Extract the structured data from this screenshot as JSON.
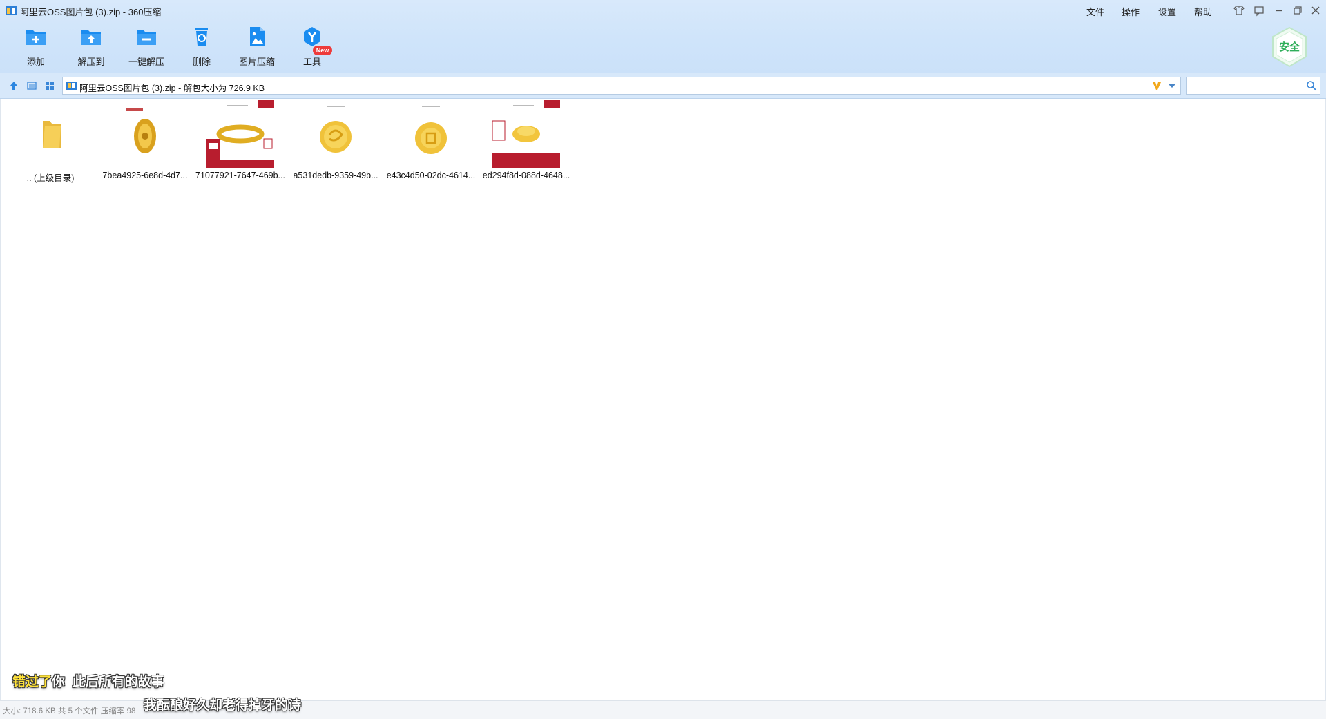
{
  "window": {
    "title": "阿里云OSS图片包 (3).zip - 360压缩",
    "menu": [
      "文件",
      "操作",
      "设置",
      "帮助"
    ]
  },
  "toolbar": {
    "tools": [
      {
        "label": "添加",
        "icon": "add-folder-icon"
      },
      {
        "label": "解压到",
        "icon": "extract-to-icon"
      },
      {
        "label": "一键解压",
        "icon": "one-click-extract-icon"
      },
      {
        "label": "删除",
        "icon": "delete-icon"
      },
      {
        "label": "图片压缩",
        "icon": "image-compress-icon"
      },
      {
        "label": "工具",
        "icon": "tools-icon"
      }
    ],
    "new_badge": "New",
    "safe_badge": "安全"
  },
  "address": {
    "path": "阿里云OSS图片包 (3).zip - 解包大小为 726.9 KB"
  },
  "search": {
    "placeholder": "",
    "value": ""
  },
  "files": [
    {
      "name": ".. (上级目录)",
      "kind": "parent-folder"
    },
    {
      "name": "7bea4925-6e8d-4d7...",
      "kind": "image"
    },
    {
      "name": "71077921-7647-469b...",
      "kind": "image"
    },
    {
      "name": "a531dedb-9359-49b...",
      "kind": "image"
    },
    {
      "name": "e43c4d50-02dc-4614...",
      "kind": "image"
    },
    {
      "name": "ed294f8d-088d-4648...",
      "kind": "image"
    }
  ],
  "status": {
    "text": "大小: 718.6 KB 共 5 个文件 压缩率 98"
  },
  "subtitles": {
    "line1_highlight": "错过了",
    "line1_rest": "你  此后所有的故事",
    "line2": "我酝酿好久却老得掉牙的诗"
  },
  "colors": {
    "toolbar_bg": "#d8e9fb",
    "icon_blue": "#1a8cf0",
    "badge_red": "#ee3b3b",
    "safe_green": "#2fae5a",
    "subtitle_highlight": "#ffe23a"
  }
}
